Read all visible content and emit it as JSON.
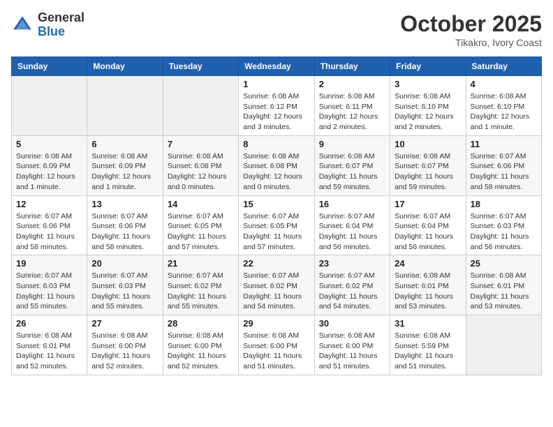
{
  "header": {
    "logo": {
      "general": "General",
      "blue": "Blue"
    },
    "title": "October 2025",
    "location": "Tikakro, Ivory Coast"
  },
  "weekdays": [
    "Sunday",
    "Monday",
    "Tuesday",
    "Wednesday",
    "Thursday",
    "Friday",
    "Saturday"
  ],
  "weeks": [
    [
      {
        "day": "",
        "info": ""
      },
      {
        "day": "",
        "info": ""
      },
      {
        "day": "",
        "info": ""
      },
      {
        "day": "1",
        "info": "Sunrise: 6:08 AM\nSunset: 6:12 PM\nDaylight: 12 hours and 3 minutes."
      },
      {
        "day": "2",
        "info": "Sunrise: 6:08 AM\nSunset: 6:11 PM\nDaylight: 12 hours and 2 minutes."
      },
      {
        "day": "3",
        "info": "Sunrise: 6:08 AM\nSunset: 6:10 PM\nDaylight: 12 hours and 2 minutes."
      },
      {
        "day": "4",
        "info": "Sunrise: 6:08 AM\nSunset: 6:10 PM\nDaylight: 12 hours and 1 minute."
      }
    ],
    [
      {
        "day": "5",
        "info": "Sunrise: 6:08 AM\nSunset: 6:09 PM\nDaylight: 12 hours and 1 minute."
      },
      {
        "day": "6",
        "info": "Sunrise: 6:08 AM\nSunset: 6:09 PM\nDaylight: 12 hours and 1 minute."
      },
      {
        "day": "7",
        "info": "Sunrise: 6:08 AM\nSunset: 6:08 PM\nDaylight: 12 hours and 0 minutes."
      },
      {
        "day": "8",
        "info": "Sunrise: 6:08 AM\nSunset: 6:08 PM\nDaylight: 12 hours and 0 minutes."
      },
      {
        "day": "9",
        "info": "Sunrise: 6:08 AM\nSunset: 6:07 PM\nDaylight: 11 hours and 59 minutes."
      },
      {
        "day": "10",
        "info": "Sunrise: 6:08 AM\nSunset: 6:07 PM\nDaylight: 11 hours and 59 minutes."
      },
      {
        "day": "11",
        "info": "Sunrise: 6:07 AM\nSunset: 6:06 PM\nDaylight: 11 hours and 58 minutes."
      }
    ],
    [
      {
        "day": "12",
        "info": "Sunrise: 6:07 AM\nSunset: 6:06 PM\nDaylight: 11 hours and 58 minutes."
      },
      {
        "day": "13",
        "info": "Sunrise: 6:07 AM\nSunset: 6:06 PM\nDaylight: 11 hours and 58 minutes."
      },
      {
        "day": "14",
        "info": "Sunrise: 6:07 AM\nSunset: 6:05 PM\nDaylight: 11 hours and 57 minutes."
      },
      {
        "day": "15",
        "info": "Sunrise: 6:07 AM\nSunset: 6:05 PM\nDaylight: 11 hours and 57 minutes."
      },
      {
        "day": "16",
        "info": "Sunrise: 6:07 AM\nSunset: 6:04 PM\nDaylight: 11 hours and 56 minutes."
      },
      {
        "day": "17",
        "info": "Sunrise: 6:07 AM\nSunset: 6:04 PM\nDaylight: 11 hours and 56 minutes."
      },
      {
        "day": "18",
        "info": "Sunrise: 6:07 AM\nSunset: 6:03 PM\nDaylight: 11 hours and 56 minutes."
      }
    ],
    [
      {
        "day": "19",
        "info": "Sunrise: 6:07 AM\nSunset: 6:03 PM\nDaylight: 11 hours and 55 minutes."
      },
      {
        "day": "20",
        "info": "Sunrise: 6:07 AM\nSunset: 6:03 PM\nDaylight: 11 hours and 55 minutes."
      },
      {
        "day": "21",
        "info": "Sunrise: 6:07 AM\nSunset: 6:02 PM\nDaylight: 11 hours and 55 minutes."
      },
      {
        "day": "22",
        "info": "Sunrise: 6:07 AM\nSunset: 6:02 PM\nDaylight: 11 hours and 54 minutes."
      },
      {
        "day": "23",
        "info": "Sunrise: 6:07 AM\nSunset: 6:02 PM\nDaylight: 11 hours and 54 minutes."
      },
      {
        "day": "24",
        "info": "Sunrise: 6:08 AM\nSunset: 6:01 PM\nDaylight: 11 hours and 53 minutes."
      },
      {
        "day": "25",
        "info": "Sunrise: 6:08 AM\nSunset: 6:01 PM\nDaylight: 11 hours and 53 minutes."
      }
    ],
    [
      {
        "day": "26",
        "info": "Sunrise: 6:08 AM\nSunset: 6:01 PM\nDaylight: 11 hours and 52 minutes."
      },
      {
        "day": "27",
        "info": "Sunrise: 6:08 AM\nSunset: 6:00 PM\nDaylight: 11 hours and 52 minutes."
      },
      {
        "day": "28",
        "info": "Sunrise: 6:08 AM\nSunset: 6:00 PM\nDaylight: 11 hours and 52 minutes."
      },
      {
        "day": "29",
        "info": "Sunrise: 6:08 AM\nSunset: 6:00 PM\nDaylight: 11 hours and 51 minutes."
      },
      {
        "day": "30",
        "info": "Sunrise: 6:08 AM\nSunset: 6:00 PM\nDaylight: 11 hours and 51 minutes."
      },
      {
        "day": "31",
        "info": "Sunrise: 6:08 AM\nSunset: 5:59 PM\nDaylight: 11 hours and 51 minutes."
      },
      {
        "day": "",
        "info": ""
      }
    ]
  ]
}
